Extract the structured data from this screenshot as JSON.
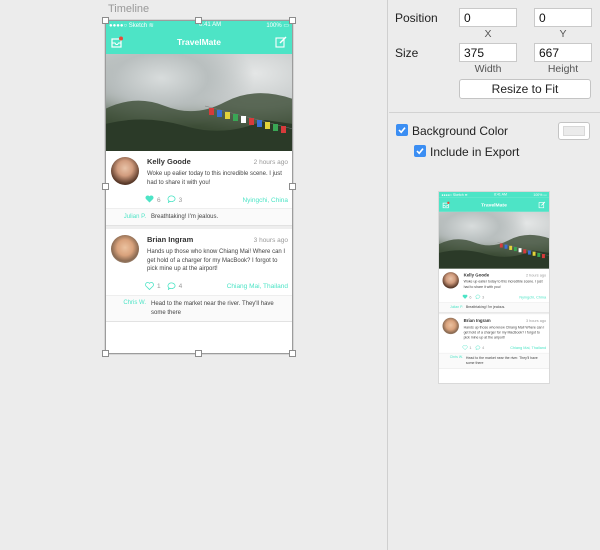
{
  "canvas": {
    "timeline_label": "Timeline"
  },
  "app": {
    "status_left": "●●●●○ Sketch ≋",
    "status_time": "8:41 AM",
    "status_right": "100% ▭",
    "title": "TravelMate",
    "posts": [
      {
        "name": "Kelly Goode",
        "time": "2 hours ago",
        "text": "Woke up ealier today to this incredible scene. I just had to share it with you!",
        "likes": "6",
        "comments": "3",
        "location": "Nyingchi, China",
        "liked": true,
        "comment_author": "Julian P.",
        "comment_text": "Breathtaking! I'm jealous."
      },
      {
        "name": "Brian Ingram",
        "time": "3 hours ago",
        "text": "Hands up those who know Chiang Mai! Where can I get hold of a charger for my MacBook? I forgot to pick mine up at the airport!",
        "likes": "1",
        "comments": "4",
        "location": "Chiang Mai, Thailand",
        "liked": false,
        "comment_author": "Chris W.",
        "comment_text": "Head to the market near the river. They'll have some there"
      }
    ],
    "accent": "#4de4c6"
  },
  "inspector": {
    "position_label": "Position",
    "position_x": "0",
    "position_y": "0",
    "x_label": "X",
    "y_label": "Y",
    "size_label": "Size",
    "width": "375",
    "height": "667",
    "width_label": "Width",
    "height_label": "Height",
    "resize_button": "Resize to Fit",
    "background_color_label": "Background Color",
    "include_export_label": "Include in Export",
    "checkbox_color": "#3b8ef3"
  }
}
